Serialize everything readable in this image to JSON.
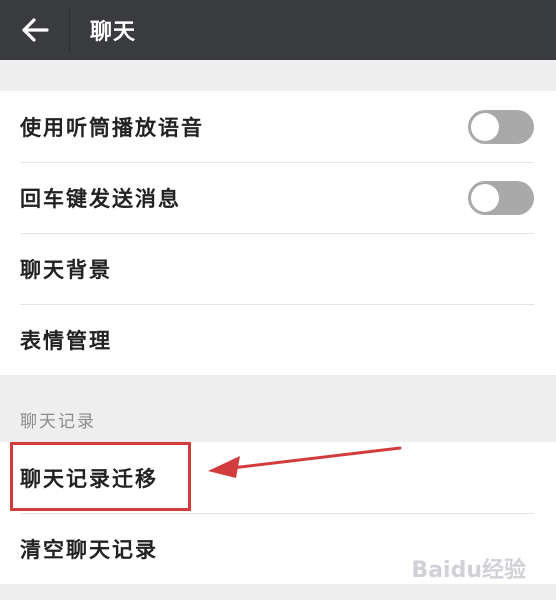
{
  "topbar": {
    "title": "聊天",
    "back_icon": "arrow-left-icon"
  },
  "settings": {
    "items": [
      {
        "label": "使用听筒播放语音",
        "toggle": false
      },
      {
        "label": "回车键发送消息",
        "toggle": false
      },
      {
        "label": "聊天背景"
      },
      {
        "label": "表情管理"
      }
    ]
  },
  "chat_history": {
    "header": "聊天记录",
    "items": [
      {
        "label": "聊天记录迁移"
      },
      {
        "label": "清空聊天记录"
      }
    ]
  },
  "annotation": {
    "highlight_color": "#d23c3c"
  },
  "watermark": {
    "text": "Baidu经验"
  },
  "colors": {
    "topbar_bg": "#3a3b3f",
    "page_bg": "#eeeeee",
    "toggle_off": "#a9a9a9"
  }
}
